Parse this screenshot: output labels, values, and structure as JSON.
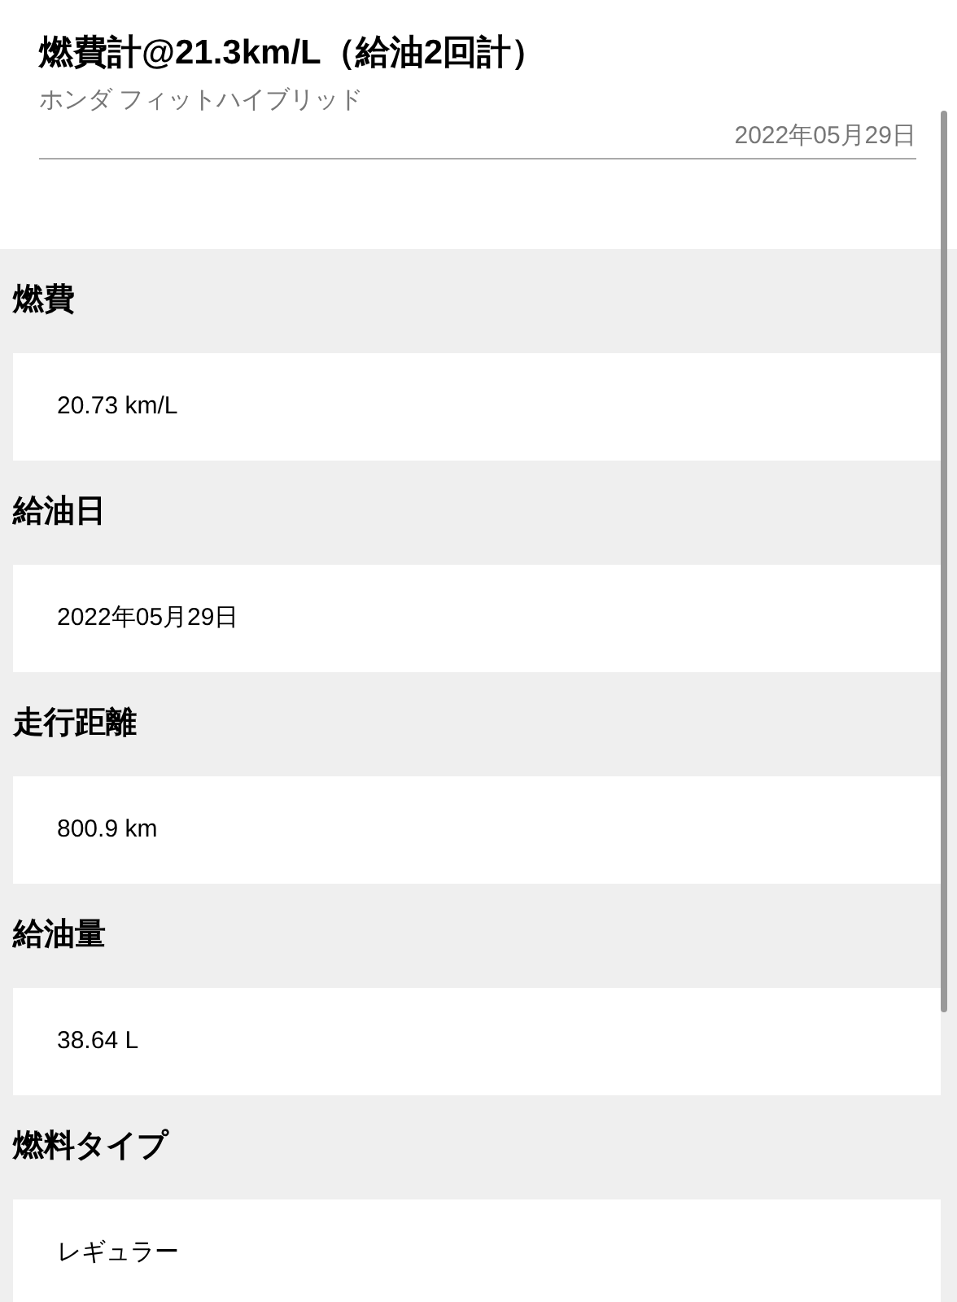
{
  "header": {
    "title": "燃費計@21.3km/L（給油2回計）",
    "subtitle": "ホンダ フィットハイブリッド",
    "date": "2022年05月29日"
  },
  "fields": [
    {
      "label": "燃費",
      "value": "20.73 km/L"
    },
    {
      "label": "給油日",
      "value": "2022年05月29日"
    },
    {
      "label": "走行距離",
      "value": "800.9 km"
    },
    {
      "label": "給油量",
      "value": "38.64 L"
    },
    {
      "label": "燃料タイプ",
      "value": "レギュラー"
    }
  ]
}
